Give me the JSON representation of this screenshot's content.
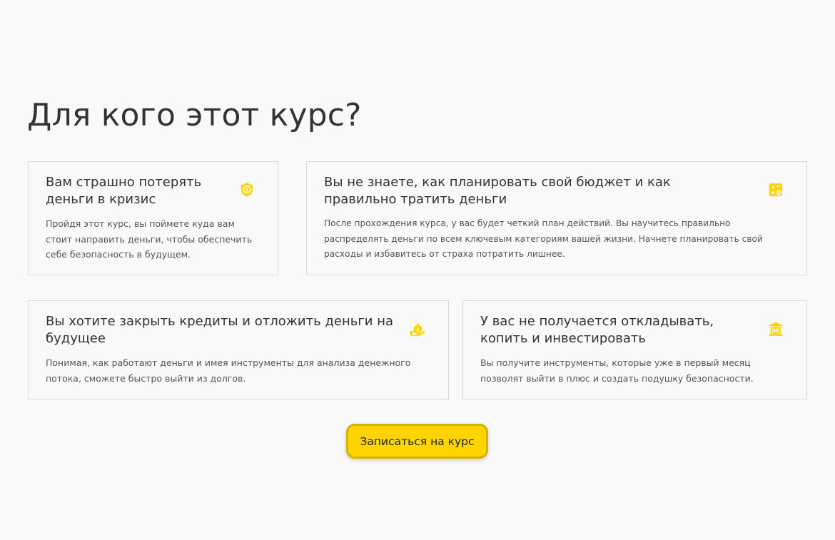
{
  "section": {
    "title": "Для кого этот курс?"
  },
  "accent_color": "#ffd400",
  "cards": [
    {
      "title": "Вам страшно потерять деньги в кризис",
      "text": "Пройдя этот курс, вы поймете куда вам стоит направить деньги, чтобы обеспечить себе безопасность в будущем.",
      "icon": "shield-dollar-icon"
    },
    {
      "title": "Вы не знаете, как планировать свой бюджет и как правильно тратить деньги",
      "text": "После прохождения курса, у вас будет четкий план действий. Вы научитесь правильно распределять деньги по всем ключевым категориям вашей жизни. Начнете планировать свой расходы и избавитесь от страха потратить лишнее.",
      "icon": "budget-planner-icon"
    },
    {
      "title": "Вы хотите закрыть кредиты и отложить деньги на будущее",
      "text": "Понимая, как работают деньги и имея инструменты для анализа денежного потока, сможете быстро выйти из долгов.",
      "icon": "hand-money-bag-icon"
    },
    {
      "title": "У вас не получается откладывать, копить и инвестировать",
      "text": "Вы получите инструменты, которые уже в первый месяц позволят выйти в плюс и создать подушку безопасности.",
      "icon": "bank-icon"
    }
  ],
  "cta": {
    "label": "Записаться на курс"
  }
}
